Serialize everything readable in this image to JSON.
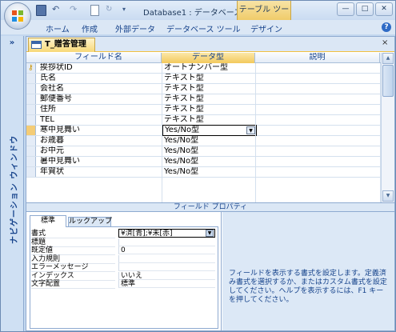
{
  "window": {
    "title": "Database1 : データベース ...",
    "context_tab": "テーブル ツール",
    "min": "—",
    "max": "□",
    "close": "✕"
  },
  "ribbon": {
    "tabs": [
      "ホーム",
      "作成",
      "外部データ",
      "データベース ツール",
      "デザイン"
    ],
    "help": "?"
  },
  "nav": {
    "toggle": "»",
    "label": "ナビゲーション ウィンドウ"
  },
  "document": {
    "tab_title": "T_贈答管理",
    "close": "×"
  },
  "grid": {
    "headers": {
      "field": "フィールド名",
      "type": "データ型",
      "description": "説明"
    },
    "rows": [
      {
        "field": "挨拶状ID",
        "type": "オートナンバー型",
        "key": true
      },
      {
        "field": "氏名",
        "type": "テキスト型"
      },
      {
        "field": "会社名",
        "type": "テキスト型"
      },
      {
        "field": "郵便番号",
        "type": "テキスト型"
      },
      {
        "field": "住所",
        "type": "テキスト型"
      },
      {
        "field": "TEL",
        "type": "テキスト型"
      },
      {
        "field": "寒中見舞い",
        "type": "Yes/No型",
        "selected": true
      },
      {
        "field": "お歳暮",
        "type": "Yes/No型"
      },
      {
        "field": "お中元",
        "type": "Yes/No型"
      },
      {
        "field": "暑中見舞い",
        "type": "Yes/No型"
      },
      {
        "field": "年賀状",
        "type": "Yes/No型"
      }
    ]
  },
  "field_properties": {
    "title": "フィールド プロパティ",
    "tabs": {
      "standard": "標準",
      "lookup": "ルックアップ"
    },
    "rows": [
      {
        "label": "書式",
        "value": "¥済[青];¥未[赤]",
        "active": true
      },
      {
        "label": "標題",
        "value": ""
      },
      {
        "label": "既定値",
        "value": "0"
      },
      {
        "label": "入力規則",
        "value": ""
      },
      {
        "label": "エラーメッセージ",
        "value": ""
      },
      {
        "label": "インデックス",
        "value": "いいえ"
      },
      {
        "label": "文字配置",
        "value": "標準"
      }
    ],
    "help": "フィールドを表示する書式を設定します。定義済み書式を選択するか、またはカスタム書式を設定してください。ヘルプを表示するには、F1 キーを押してください。"
  },
  "icons": {
    "office_button": "office-logo-icon",
    "save": "save-icon",
    "undo": "undo-icon",
    "redo": "redo-icon",
    "key": "primary-key-icon",
    "dropdown": "chevron-down-icon"
  }
}
